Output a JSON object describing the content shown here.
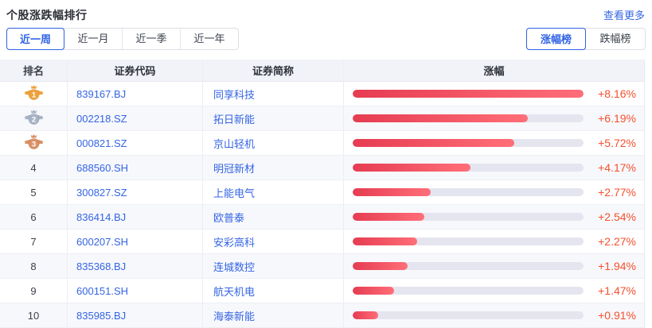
{
  "page": {
    "title": "个股涨跌幅排行",
    "more_link": "查看更多"
  },
  "period_tabs": [
    {
      "label": "近一周",
      "active": true
    },
    {
      "label": "近一月",
      "active": false
    },
    {
      "label": "近一季",
      "active": false
    },
    {
      "label": "近一年",
      "active": false
    }
  ],
  "board_tabs": [
    {
      "label": "涨幅榜",
      "active": true
    },
    {
      "label": "跌幅榜",
      "active": false
    }
  ],
  "table": {
    "columns": {
      "rank": "排名",
      "code": "证券代码",
      "name": "证券简称",
      "change": "涨幅"
    },
    "bar_scale_max": 8.16,
    "rows": [
      {
        "rank": 1,
        "medal": "gold",
        "code": "839167.BJ",
        "name": "同享科技",
        "pct": 8.16,
        "change_label": "+8.16%"
      },
      {
        "rank": 2,
        "medal": "silver",
        "code": "002218.SZ",
        "name": "拓日新能",
        "pct": 6.19,
        "change_label": "+6.19%"
      },
      {
        "rank": 3,
        "medal": "bronze",
        "code": "000821.SZ",
        "name": "京山轻机",
        "pct": 5.72,
        "change_label": "+5.72%"
      },
      {
        "rank": 4,
        "medal": null,
        "code": "688560.SH",
        "name": "明冠新材",
        "pct": 4.17,
        "change_label": "+4.17%"
      },
      {
        "rank": 5,
        "medal": null,
        "code": "300827.SZ",
        "name": "上能电气",
        "pct": 2.77,
        "change_label": "+2.77%"
      },
      {
        "rank": 6,
        "medal": null,
        "code": "836414.BJ",
        "name": "欧普泰",
        "pct": 2.54,
        "change_label": "+2.54%"
      },
      {
        "rank": 7,
        "medal": null,
        "code": "600207.SH",
        "name": "安彩高科",
        "pct": 2.27,
        "change_label": "+2.27%"
      },
      {
        "rank": 8,
        "medal": null,
        "code": "835368.BJ",
        "name": "连城数控",
        "pct": 1.94,
        "change_label": "+1.94%"
      },
      {
        "rank": 9,
        "medal": null,
        "code": "600151.SH",
        "name": "航天机电",
        "pct": 1.47,
        "change_label": "+1.47%"
      },
      {
        "rank": 10,
        "medal": null,
        "code": "835985.BJ",
        "name": "海泰新能",
        "pct": 0.91,
        "change_label": "+0.91%"
      }
    ]
  },
  "colors": {
    "accent_blue": "#2f62e4",
    "link_blue": "#3465e3",
    "rise_red": "#f4502e",
    "bar_gradient_start": "#e63c52",
    "bar_gradient_end": "#ff6e78",
    "bar_track": "#e5e5ef",
    "row_stripe": "#f7f8fc",
    "header_bg": "#f2f3f8",
    "medal_gold": "#efa33e",
    "medal_silver": "#a6b4c6",
    "medal_bronze": "#db9166"
  }
}
